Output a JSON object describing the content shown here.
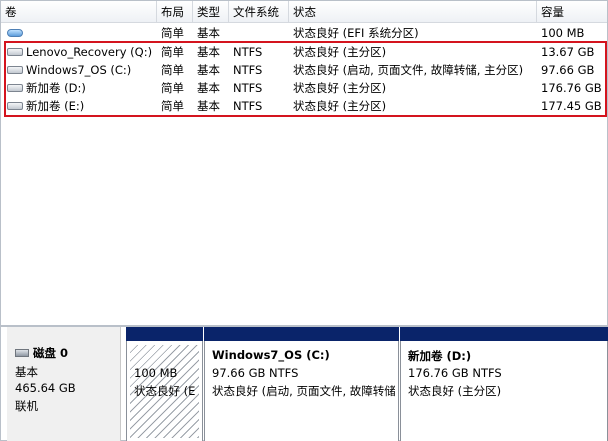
{
  "columns": [
    "卷",
    "布局",
    "类型",
    "文件系统",
    "状态",
    "容量"
  ],
  "volumes": [
    {
      "name": "",
      "layout": "简单",
      "type": "基本",
      "fs": "",
      "status": "状态良好 (EFI 系统分区)",
      "capacity": "100 MB",
      "icon": "efi-volume-icon"
    },
    {
      "name": "Lenovo_Recovery (Q:)",
      "layout": "简单",
      "type": "基本",
      "fs": "NTFS",
      "status": "状态良好 (主分区)",
      "capacity": "13.67 GB",
      "icon": "drive-volume-icon"
    },
    {
      "name": "Windows7_OS (C:)",
      "layout": "简单",
      "type": "基本",
      "fs": "NTFS",
      "status": "状态良好 (启动, 页面文件, 故障转储, 主分区)",
      "capacity": "97.66 GB",
      "icon": "drive-volume-icon"
    },
    {
      "name": "新加卷 (D:)",
      "layout": "简单",
      "type": "基本",
      "fs": "NTFS",
      "status": "状态良好 (主分区)",
      "capacity": "176.76 GB",
      "icon": "drive-volume-icon"
    },
    {
      "name": "新加卷 (E:)",
      "layout": "简单",
      "type": "基本",
      "fs": "NTFS",
      "status": "状态良好 (主分区)",
      "capacity": "177.45 GB",
      "icon": "drive-volume-icon"
    }
  ],
  "disk": {
    "name": "磁盘 0",
    "type": "基本",
    "size": "465.64 GB",
    "state": "联机"
  },
  "partitions": [
    {
      "title": "",
      "size": "100 MB",
      "status": "状态良好 (E"
    },
    {
      "title": "Windows7_OS  (C:)",
      "size": "97.66 GB NTFS",
      "status": "状态良好 (启动, 页面文件, 故障转储"
    },
    {
      "title": "新加卷  (D:)",
      "size": "176.76 GB NTFS",
      "status": "状态良好 (主分区)"
    }
  ],
  "colors": {
    "selection_outline": "#d4141e",
    "partition_bar": "#0a246a"
  }
}
